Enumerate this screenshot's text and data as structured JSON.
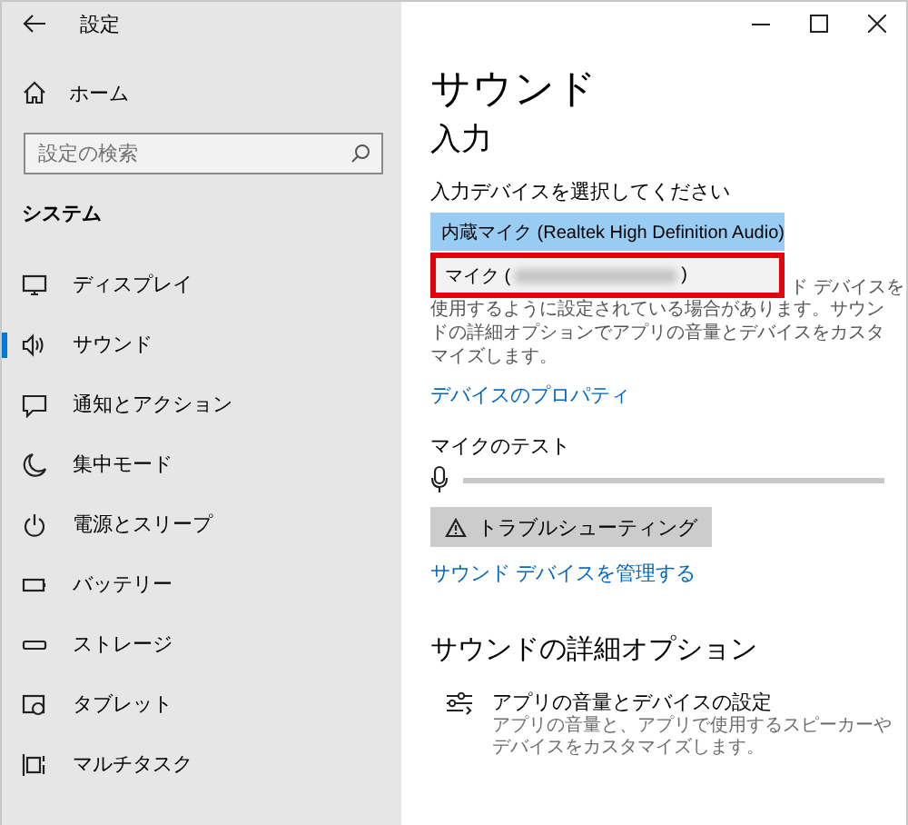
{
  "window": {
    "title": "設定"
  },
  "sidebar": {
    "home": "ホーム",
    "search": {
      "placeholder": "設定の検索"
    },
    "section": "システム",
    "items": [
      {
        "label": "ディスプレイ",
        "selected": false
      },
      {
        "label": "サウンド",
        "selected": true
      },
      {
        "label": "通知とアクション",
        "selected": false
      },
      {
        "label": "集中モード",
        "selected": false
      },
      {
        "label": "電源とスリープ",
        "selected": false
      },
      {
        "label": "バッテリー",
        "selected": false
      },
      {
        "label": "ストレージ",
        "selected": false
      },
      {
        "label": "タブレット",
        "selected": false
      },
      {
        "label": "マルチタスク",
        "selected": false
      }
    ]
  },
  "content": {
    "title": "サウンド",
    "input": {
      "heading": "入力",
      "device_label": "入力デバイスを選択してください",
      "dropdown": {
        "options": [
          {
            "label_start": "内蔵マイク (Realtek High Definition Audio)",
            "selected": true,
            "highlighted": false
          },
          {
            "label_start": "マイク (",
            "label_end": ")",
            "selected": false,
            "highlighted": true
          }
        ]
      },
      "note_start": "ド デバイスを",
      "note": "使用するように設定されている場合があります。サウンドの詳細オプションでアプリの音量とデバイスをカスタマイズします。",
      "properties_link": "デバイスのプロパティ",
      "mic_test": {
        "label": "マイクのテスト",
        "level": 0
      },
      "troubleshoot": "トラブルシューティング",
      "manage_link": "サウンド デバイスを管理する"
    },
    "advanced": {
      "heading": "サウンドの詳細オプション",
      "item": {
        "title": "アプリの音量とデバイスの設定",
        "description": "アプリの音量と、アプリで使用するスピーカーやデバイスをカスタマイズします。"
      }
    }
  }
}
